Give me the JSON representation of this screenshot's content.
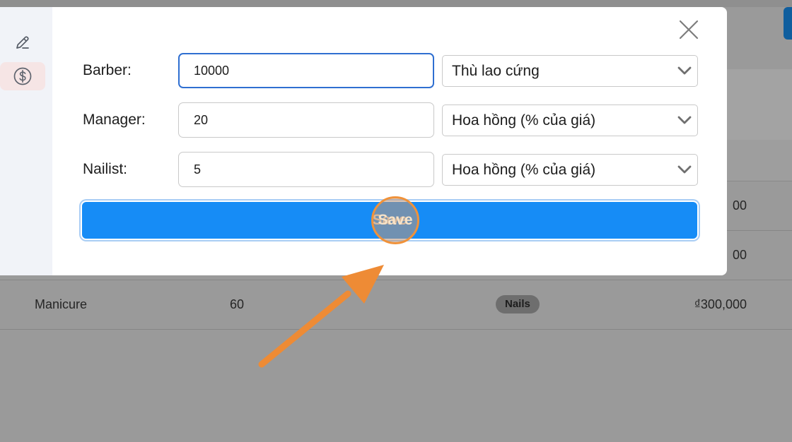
{
  "background": {
    "rows": [
      {
        "name": "",
        "duration": "",
        "category": "",
        "price": "00"
      },
      {
        "name": "",
        "duration": "",
        "category": "",
        "price": "00"
      },
      {
        "name": "Manicure",
        "duration": "60",
        "category": "Nails",
        "price": "₫300,000"
      }
    ]
  },
  "sidebar": {
    "items": [
      {
        "icon": "pencil-icon"
      },
      {
        "icon": "dollar-circle-icon",
        "active": true
      }
    ]
  },
  "modal": {
    "close_icon": "close-icon",
    "fields": [
      {
        "label": "Barber:",
        "value": "10000",
        "type_selected": "Thù lao cứng",
        "focused": true
      },
      {
        "label": "Manager:",
        "value": "20",
        "type_selected": "Hoa hồng (% của giá)"
      },
      {
        "label": "Nailist:",
        "value": "5",
        "type_selected": "Hoa hồng (% của giá)"
      }
    ],
    "save_label": "Save"
  },
  "colors": {
    "accent": "#168cf6",
    "focus_border": "#2f6fd1",
    "annotation": "#f0923a"
  }
}
